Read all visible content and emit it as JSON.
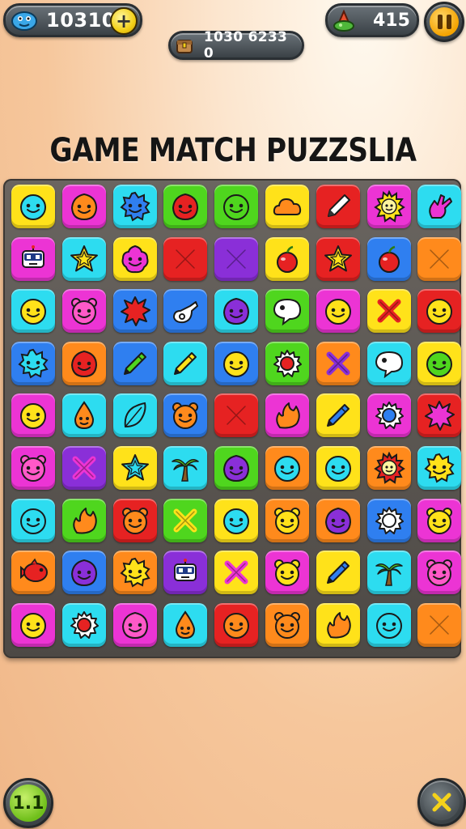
{
  "hud": {
    "coins": "10310",
    "plus_label": "+",
    "score_text": "1030 6233 0",
    "gems": "415"
  },
  "title": "GAME MATCH PUZZSLIA",
  "level": "1.1",
  "colors": {
    "yellow": "#ffe21a",
    "magenta": "#ec34d4",
    "cyan": "#2ddcf0",
    "green": "#4fd61e",
    "orange": "#ff8a1c",
    "red": "#e62222",
    "purple": "#8a2fd8",
    "blue": "#2f7ff0",
    "pink": "#ff59c8"
  },
  "board": {
    "rows": [
      [
        [
          "yellow",
          "smiley-icon",
          "cyan"
        ],
        [
          "magenta",
          "blob-face-icon",
          "orange"
        ],
        [
          "cyan",
          "spiky-face-icon",
          "blue"
        ],
        [
          "green",
          "blob-face-icon",
          "red"
        ],
        [
          "green",
          "smiley-icon",
          "green"
        ],
        [
          "yellow",
          "cloud-icon",
          "orange"
        ],
        [
          "red",
          "pencil-icon",
          "white"
        ],
        [
          "magenta",
          "sun-face-icon",
          "yellow"
        ],
        [
          "cyan",
          "hand-icon",
          "magenta"
        ]
      ],
      [
        [
          "magenta",
          "robot-icon",
          "white"
        ],
        [
          "cyan",
          "star-icon",
          "yellow"
        ],
        [
          "yellow",
          "flower-face-icon",
          "magenta"
        ],
        [
          "red",
          "cross-icon",
          "red"
        ],
        [
          "purple",
          "cross-icon",
          "purple"
        ],
        [
          "yellow",
          "cherry-icon",
          "red"
        ],
        [
          "red",
          "star-icon",
          "yellow"
        ],
        [
          "blue",
          "cherry-icon",
          "red"
        ],
        [
          "orange",
          "cross-icon",
          "orange"
        ]
      ],
      [
        [
          "cyan",
          "smiley-icon",
          "yellow"
        ],
        [
          "magenta",
          "bear-face-icon",
          "pink"
        ],
        [
          "blue",
          "splat-icon",
          "red"
        ],
        [
          "blue",
          "whistle-icon",
          "white"
        ],
        [
          "cyan",
          "blob-face-icon",
          "purple"
        ],
        [
          "green",
          "speech-bubble-icon",
          "white"
        ],
        [
          "magenta",
          "smiley-icon",
          "yellow"
        ],
        [
          "yellow",
          "cross-icon",
          "red"
        ],
        [
          "red",
          "smiley-icon",
          "yellow"
        ]
      ],
      [
        [
          "blue",
          "spiky-face-icon",
          "cyan"
        ],
        [
          "orange",
          "blob-face-icon",
          "red"
        ],
        [
          "blue",
          "crayon-icon",
          "green"
        ],
        [
          "cyan",
          "crayon-icon",
          "yellow"
        ],
        [
          "blue",
          "smiley-icon",
          "yellow"
        ],
        [
          "green",
          "gear-icon",
          "red"
        ],
        [
          "orange",
          "cross-icon",
          "purple"
        ],
        [
          "cyan",
          "speech-bubble-icon",
          "white"
        ],
        [
          "yellow",
          "smiley-icon",
          "green"
        ]
      ],
      [
        [
          "magenta",
          "smiley-icon",
          "yellow"
        ],
        [
          "cyan",
          "drop-face-icon",
          "orange"
        ],
        [
          "cyan",
          "leaf-icon",
          "cyan"
        ],
        [
          "blue",
          "bear-face-icon",
          "orange"
        ],
        [
          "red",
          "cross-icon",
          "red"
        ],
        [
          "magenta",
          "flame-icon",
          "orange"
        ],
        [
          "yellow",
          "crayon-icon",
          "blue"
        ],
        [
          "magenta",
          "gear-icon",
          "blue"
        ],
        [
          "red",
          "splat-icon",
          "magenta"
        ]
      ],
      [
        [
          "magenta",
          "bear-face-icon",
          "pink"
        ],
        [
          "purple",
          "cross-icon",
          "magenta"
        ],
        [
          "yellow",
          "star-icon",
          "cyan"
        ],
        [
          "cyan",
          "palm-tree-icon",
          "green"
        ],
        [
          "green",
          "blob-face-icon",
          "purple"
        ],
        [
          "orange",
          "smiley-icon",
          "cyan"
        ],
        [
          "yellow",
          "smiley-icon",
          "cyan"
        ],
        [
          "orange",
          "sun-face-icon",
          "red"
        ],
        [
          "cyan",
          "spiky-face-icon",
          "yellow"
        ]
      ],
      [
        [
          "cyan",
          "smiley-icon",
          "cyan"
        ],
        [
          "green",
          "flame-icon",
          "orange"
        ],
        [
          "red",
          "bear-face-icon",
          "orange"
        ],
        [
          "green",
          "cross-icon",
          "yellow"
        ],
        [
          "yellow",
          "smiley-icon",
          "cyan"
        ],
        [
          "orange",
          "bear-face-icon",
          "yellow"
        ],
        [
          "orange",
          "blob-face-icon",
          "purple"
        ],
        [
          "blue",
          "gear-icon",
          "white"
        ],
        [
          "magenta",
          "bear-face-icon",
          "yellow"
        ]
      ],
      [
        [
          "orange",
          "fish-icon",
          "red"
        ],
        [
          "blue",
          "blob-face-icon",
          "purple"
        ],
        [
          "orange",
          "spiky-face-icon",
          "yellow"
        ],
        [
          "purple",
          "robot-icon",
          "white"
        ],
        [
          "yellow",
          "cross-icon",
          "magenta"
        ],
        [
          "magenta",
          "bear-face-icon",
          "yellow"
        ],
        [
          "yellow",
          "crayon-icon",
          "blue"
        ],
        [
          "cyan",
          "palm-tree-icon",
          "green"
        ],
        [
          "magenta",
          "bear-face-icon",
          "pink"
        ]
      ],
      [
        [
          "magenta",
          "smiley-icon",
          "yellow"
        ],
        [
          "cyan",
          "gear-icon",
          "red"
        ],
        [
          "magenta",
          "blob-face-icon",
          "pink"
        ],
        [
          "cyan",
          "drop-face-icon",
          "orange"
        ],
        [
          "red",
          "smiley-icon",
          "orange"
        ],
        [
          "orange",
          "bear-face-icon",
          "orange"
        ],
        [
          "yellow",
          "flame-icon",
          "orange"
        ],
        [
          "cyan",
          "smiley-icon",
          "cyan"
        ],
        [
          "orange",
          "cross-icon",
          "orange"
        ]
      ]
    ]
  }
}
